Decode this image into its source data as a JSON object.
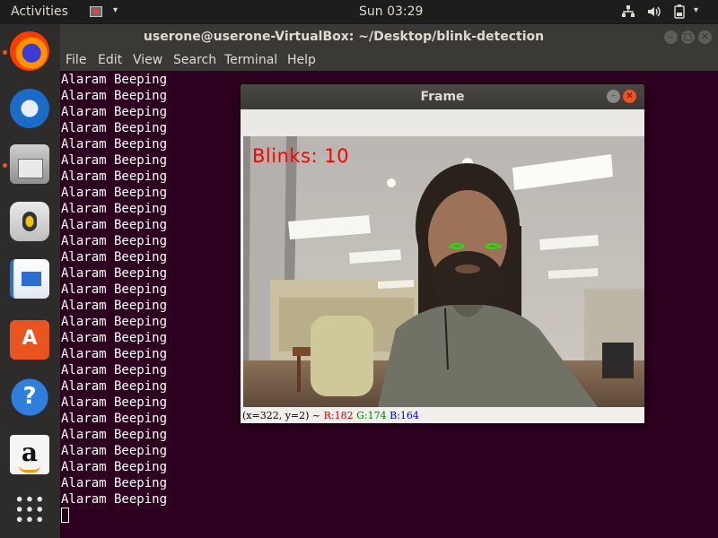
{
  "topbar": {
    "activities": "Activities",
    "clock": "Sun 03:29",
    "menu_arrow": "▾",
    "tray": {
      "network_icon": "network-icon",
      "volume_icon": "volume-icon",
      "battery_icon": "battery-icon",
      "arrow": "▾"
    }
  },
  "dock": {
    "items": [
      {
        "name": "firefox",
        "running": true
      },
      {
        "name": "thunderbird",
        "running": false
      },
      {
        "name": "files",
        "running": true
      },
      {
        "name": "rhythmbox",
        "running": false
      },
      {
        "name": "libreoffice-writer",
        "running": false
      },
      {
        "name": "ubuntu-software",
        "running": false,
        "glyph": "A"
      },
      {
        "name": "help",
        "running": false,
        "glyph": "?"
      },
      {
        "name": "amazon",
        "running": false,
        "glyph": "a"
      },
      {
        "name": "show-applications",
        "running": false
      }
    ]
  },
  "terminal": {
    "title": "userone@userone-VirtualBox: ~/Desktop/blink-detection",
    "menu": [
      "File",
      "Edit",
      "View",
      "Search",
      "Terminal",
      "Help"
    ],
    "output_line": "Alaram Beeping",
    "output_line_count": 27
  },
  "frame_window": {
    "title": "Frame",
    "overlay_text": "Blinks: 10",
    "status": {
      "coords": "(x=322, y=2) ~",
      "r": "R:182",
      "g": "G:174",
      "b": "B:164"
    }
  },
  "colors": {
    "terminal_bg": "#2c001e",
    "accent": "#e95420",
    "overlay_text": "#ff0000",
    "eye_contour": "#00ff00"
  }
}
